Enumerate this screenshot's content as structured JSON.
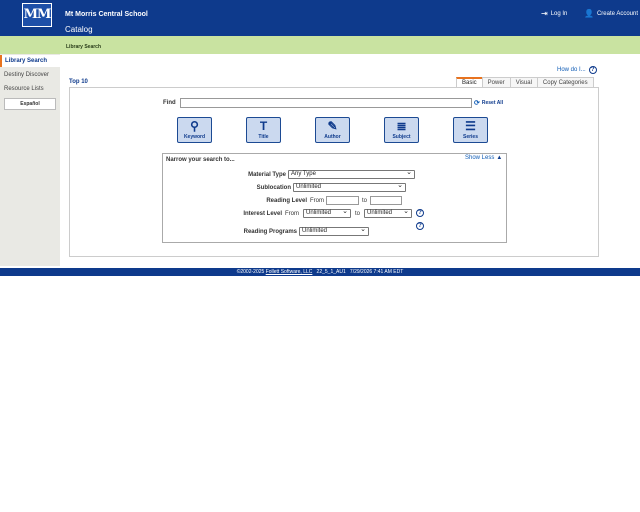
{
  "header": {
    "logo_text": "MM",
    "school_name": "Mt Morris Central School",
    "catalog_tab": "Catalog",
    "login": "Log In",
    "create_account": "Create Account"
  },
  "subbar": {
    "label": "Library Search"
  },
  "sidebar": {
    "items": [
      {
        "label": "Library Search"
      },
      {
        "label": "Destiny Discover"
      },
      {
        "label": "Resource Lists"
      }
    ],
    "language_button": "Español"
  },
  "main": {
    "how_do_i": "How do I...",
    "top10": "Top 10",
    "tabs": [
      {
        "label": "Basic"
      },
      {
        "label": "Power"
      },
      {
        "label": "Visual"
      },
      {
        "label": "Copy Categories"
      }
    ],
    "find_label": "Find",
    "find_value": "",
    "reset_all": "Reset All",
    "search_buttons": [
      {
        "label": "Keyword"
      },
      {
        "label": "Title"
      },
      {
        "label": "Author"
      },
      {
        "label": "Subject"
      },
      {
        "label": "Series"
      }
    ],
    "narrow": {
      "title": "Narrow your search to...",
      "show_less": "Show Less",
      "material_type_label": "Material Type",
      "material_type_value": "Any Type",
      "sublocation_label": "Sublocation",
      "sublocation_value": "Unlimited",
      "reading_level_label": "Reading Level",
      "from": "From",
      "to": "to",
      "reading_from": "",
      "reading_to": "",
      "interest_level_label": "Interest Level",
      "interest_from": "Unlimited",
      "interest_to": "Unlimited",
      "reading_programs_label": "Reading Programs",
      "reading_programs_value": "Unlimited"
    }
  },
  "footer": {
    "copyright": "©2002-2025",
    "company_link": "Follett Software, LLC",
    "version": "22_5_1_AU1",
    "datetime": "7/29/2026 7:41 AM EDT"
  },
  "colors": {
    "header_bg": "#0e3a8c",
    "subbar_bg": "#c9e3a1",
    "accent": "#e8731f",
    "sidebar_bg": "#e9e9e4"
  }
}
